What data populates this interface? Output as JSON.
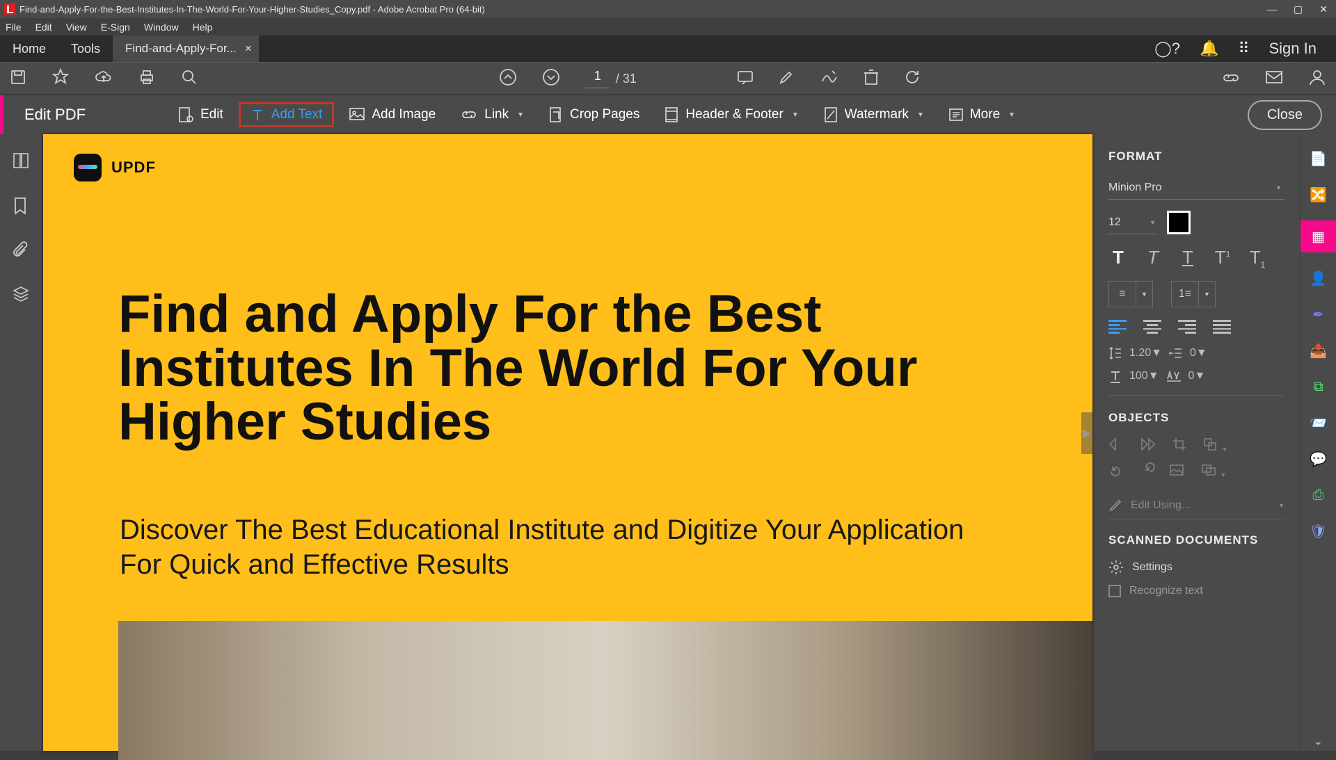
{
  "title_bar": {
    "title": "Find-and-Apply-For-the-Best-Institutes-In-The-World-For-Your-Higher-Studies_Copy.pdf - Adobe Acrobat Pro (64-bit)"
  },
  "menu": {
    "file": "File",
    "edit": "Edit",
    "view": "View",
    "esign": "E-Sign",
    "window": "Window",
    "help": "Help"
  },
  "tabs": {
    "home": "Home",
    "tools": "Tools",
    "doc": "Find-and-Apply-For...",
    "close": "×",
    "signin": "Sign In"
  },
  "page_nav": {
    "current": "1",
    "total": "/ 31"
  },
  "edit_bar": {
    "label": "Edit PDF",
    "edit": "Edit",
    "add_text": "Add Text",
    "add_image": "Add Image",
    "link": "Link",
    "crop_pages": "Crop Pages",
    "header_footer": "Header & Footer",
    "watermark": "Watermark",
    "more": "More",
    "close": "Close"
  },
  "doc": {
    "brand": "UPDF",
    "headline": "Find and Apply For the Best Institutes In The World For Your Higher Studies",
    "subhead": "Discover The Best Educational Institute and Digitize Your Application For Quick and Effective Results"
  },
  "format": {
    "title": "FORMAT",
    "font": "Minion Pro",
    "size": "12",
    "line_height": "1.20",
    "indent": "0",
    "hscale": "100",
    "tracking": "0",
    "objects_title": "OBJECTS",
    "edit_using": "Edit Using...",
    "scanned_title": "SCANNED DOCUMENTS",
    "settings": "Settings",
    "recognize": "Recognize text"
  }
}
